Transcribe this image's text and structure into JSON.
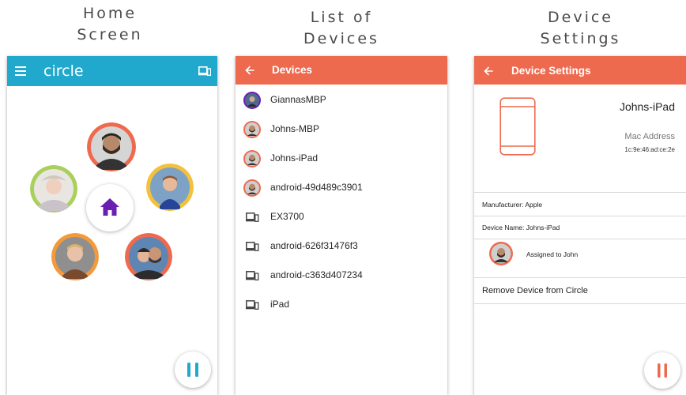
{
  "captions": {
    "home": [
      "Home",
      "Screen"
    ],
    "list": [
      "List of",
      "Devices"
    ],
    "settings": [
      "Device",
      "Settings"
    ]
  },
  "home_screen": {
    "app_name": "circle",
    "accent": "#20a9cc",
    "home_button_color": "#6a1fb3",
    "pause_color": "#20a9cc",
    "profile_ring_colors": [
      "#ee6a4f",
      "#a9d05a",
      "#f3c13c",
      "#f39a3c",
      "#ee6a4f"
    ]
  },
  "devices_screen": {
    "title": "Devices",
    "accent": "#ee6a4f",
    "devices": [
      {
        "name": "GiannasMBP",
        "icon": "avatar"
      },
      {
        "name": "Johns-MBP",
        "icon": "avatar"
      },
      {
        "name": "Johns-iPad",
        "icon": "avatar"
      },
      {
        "name": "android-49d489c3901",
        "icon": "avatar"
      },
      {
        "name": "EX3700",
        "icon": "devices-icon"
      },
      {
        "name": "android-626f31476f3",
        "icon": "devices-icon"
      },
      {
        "name": "android-c363d407234",
        "icon": "devices-icon"
      },
      {
        "name": "iPad",
        "icon": "devices-icon"
      }
    ]
  },
  "settings_screen": {
    "title": "Device Settings",
    "device_name": "Johns-iPad",
    "mac_label": "Mac Address",
    "mac_value": "1c:9e:46:ad:ce:2e",
    "manufacturer": "Manufacturer: Apple",
    "device_name_row": "Device Name: Johns-iPad",
    "assigned": "Assigned to John",
    "remove": "Remove Device from Circle",
    "pause_color": "#ee6a4f"
  }
}
